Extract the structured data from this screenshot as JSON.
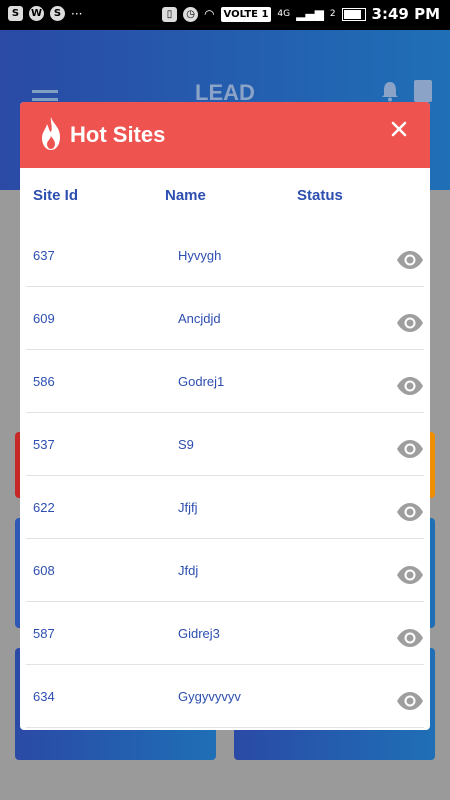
{
  "status_bar": {
    "network_label": "VOLTE 1",
    "sim_label": "4G",
    "signal_label_2": "2",
    "time": "3:49 PM"
  },
  "app_bar": {
    "title": "LEAD"
  },
  "dialog": {
    "title": "Hot Sites",
    "header_color": "#ef5350",
    "columns": {
      "site_id": "Site Id",
      "name": "Name",
      "status": "Status"
    },
    "rows": [
      {
        "site_id": "637",
        "name": "Hyvygh"
      },
      {
        "site_id": "609",
        "name": "Ancjdjd"
      },
      {
        "site_id": "586",
        "name": "Godrej1"
      },
      {
        "site_id": "537",
        "name": "S9"
      },
      {
        "site_id": "622",
        "name": "Jfjfj"
      },
      {
        "site_id": "608",
        "name": "Jfdj"
      },
      {
        "site_id": "587",
        "name": "Gidrej3"
      },
      {
        "site_id": "634",
        "name": "Gygyvyvyv"
      }
    ]
  },
  "colors": {
    "primary_text": "#2d4fb0",
    "app_bar_gradient_start": "#2a4aa6",
    "app_bar_gradient_end": "#1f6fb6",
    "eye_icon": "#9e9e9e"
  },
  "icons": {
    "menu": "hamburger-icon",
    "notifications": "bell-icon",
    "documents": "document-icon",
    "title": "flame-icon",
    "close": "close-icon",
    "status": "eye-icon"
  }
}
